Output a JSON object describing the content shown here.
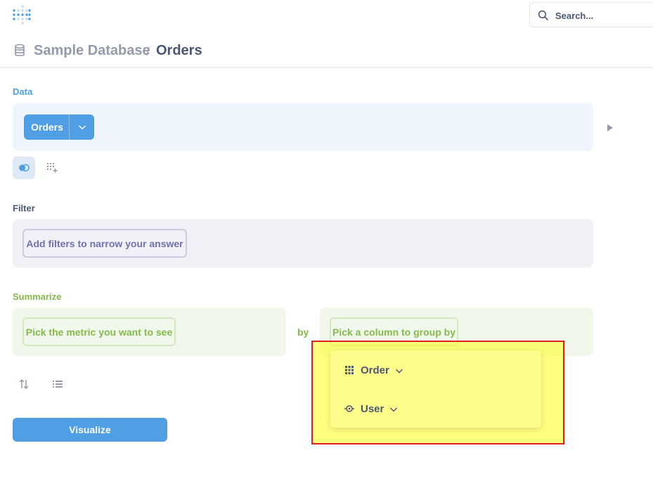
{
  "search": {
    "placeholder": "Search..."
  },
  "breadcrumb": {
    "database": "Sample Database",
    "separator": "/",
    "table": "Orders"
  },
  "data_section": {
    "label": "Data",
    "table": "Orders"
  },
  "filter_section": {
    "label": "Filter",
    "add_filter": "Add filters to narrow your answer"
  },
  "summarize_section": {
    "label": "Summarize",
    "metric_placeholder": "Pick the metric you want to see",
    "by": "by",
    "group_placeholder": "Pick a column to group by"
  },
  "group_popover": {
    "items": [
      {
        "label": "Order",
        "icon": "table-grid-icon"
      },
      {
        "label": "User",
        "icon": "connection-icon"
      }
    ]
  },
  "actions": {
    "visualize": "Visualize"
  },
  "colors": {
    "brand": "#509ee3",
    "filter": "#7172ad",
    "summarize": "#84bb4c",
    "highlight_border": "#e02020",
    "highlight_fill": "#ffff00"
  }
}
